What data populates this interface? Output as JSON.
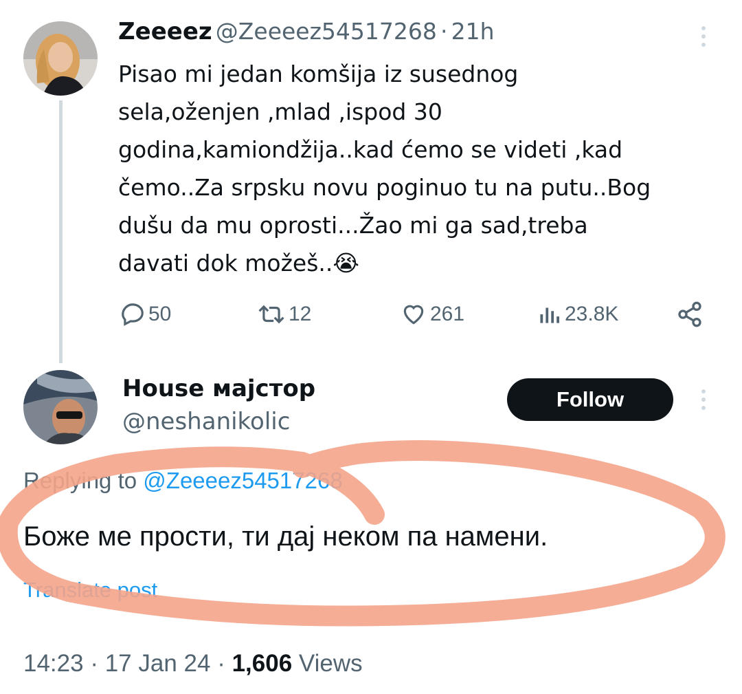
{
  "original_tweet": {
    "display_name": "Zeeeez",
    "handle": "@Zeeeez54517268",
    "separator": "·",
    "time_ago": "21h",
    "text_lines": [
      "Pisao mi jedan komšija iz susednog",
      "sela,oženjen ,mlad ,ispod 30",
      "godina,kamiondžija..kad ćemo se videti ,kad",
      "čemo..Za srpsku novu poginuo tu na putu..Bog",
      "dušu da mu oprosti...Žao mi ga sad,treba",
      "davati dok možeš.."
    ],
    "emoji": "😭",
    "replies": "50",
    "reposts": "12",
    "likes": "261",
    "views": "23.8K"
  },
  "reply_tweet": {
    "display_name": "House мајстор",
    "handle": "@neshanikolic",
    "follow_label": "Follow",
    "replying_prefix": "Replying to",
    "replying_handle": "@Zeeeez54517268",
    "text": "Боже ме прости, ти дај неком па намени.",
    "translate_label": "Translate post",
    "time": "14:23",
    "date": "17 Jan 24",
    "separator": "·",
    "views_count": "1,606",
    "views_label": "Views"
  },
  "colors": {
    "annotation_circle": "#f4a48a",
    "link_blue": "#1d9bf0",
    "secondary_text": "#536471"
  }
}
